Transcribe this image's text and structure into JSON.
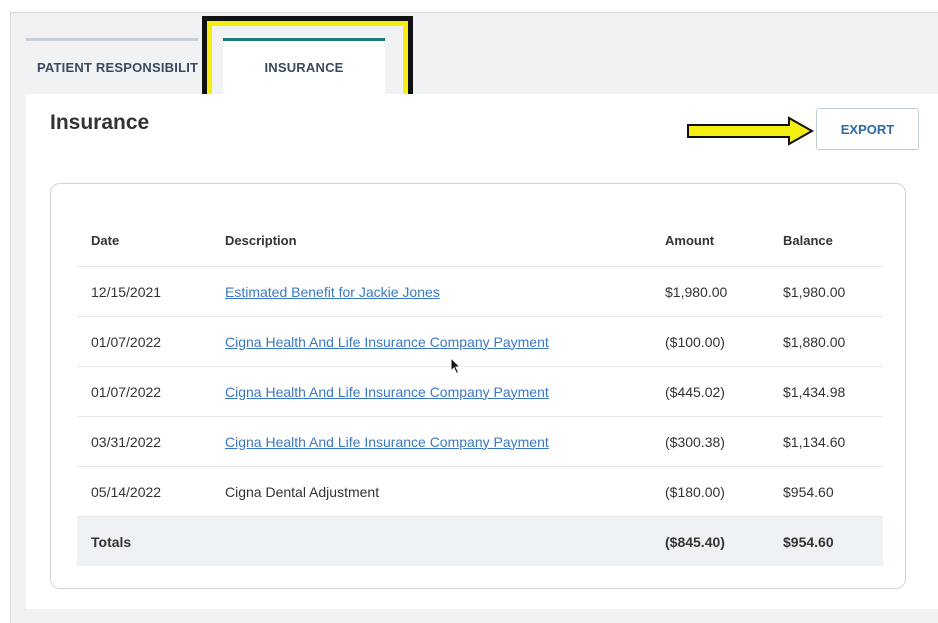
{
  "tabs": [
    {
      "label": "PATIENT RESPONSIBILITY"
    },
    {
      "label": "INSURANCE"
    }
  ],
  "page": {
    "heading": "Insurance",
    "export_label": "EXPORT"
  },
  "table": {
    "headers": {
      "date": "Date",
      "description": "Description",
      "amount": "Amount",
      "balance": "Balance"
    },
    "rows": [
      {
        "date": "12/15/2021",
        "description": "Estimated Benefit for Jackie Jones",
        "amount": "$1,980.00",
        "balance": "$1,980.00",
        "link": true
      },
      {
        "date": "01/07/2022",
        "description": "Cigna Health And Life Insurance Company Payment",
        "amount": "($100.00)",
        "balance": "$1,880.00",
        "link": true
      },
      {
        "date": "01/07/2022",
        "description": "Cigna Health And Life Insurance Company Payment",
        "amount": "($445.02)",
        "balance": "$1,434.98",
        "link": true
      },
      {
        "date": "03/31/2022",
        "description": "Cigna Health And Life Insurance Company Payment",
        "amount": "($300.38)",
        "balance": "$1,134.60",
        "link": true
      },
      {
        "date": "05/14/2022",
        "description": "Cigna Dental Adjustment",
        "amount": "($180.00)",
        "balance": "$954.60",
        "link": false
      }
    ],
    "totals": {
      "label": "Totals",
      "amount": "($845.40)",
      "balance": "$954.60"
    }
  },
  "colors": {
    "highlight": "#f5ee11",
    "accent_tab": "#1f7a7a",
    "link": "#3b78c2"
  }
}
